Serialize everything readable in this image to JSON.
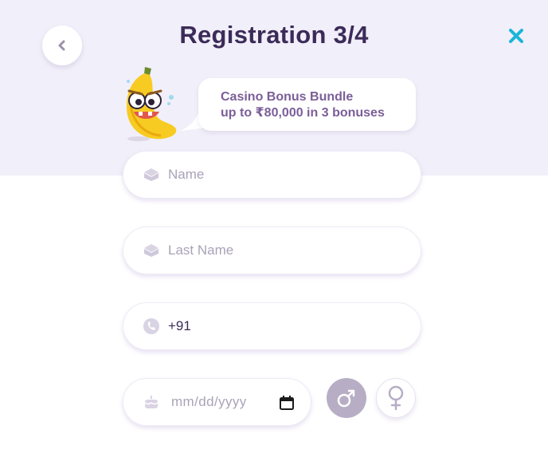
{
  "header": {
    "title": "Registration 3/4"
  },
  "promo": {
    "line1": "Casino Bonus Bundle",
    "line2": "up to ₹80,000 in 3 bonuses"
  },
  "form": {
    "name_placeholder": "Name",
    "last_name_placeholder": "Last Name",
    "phone_value": "+91",
    "date_placeholder": "mm/dd/yyyy",
    "gender_selected": "male"
  },
  "colors": {
    "header_bg": "#f1eff9",
    "title": "#3c2b59",
    "close_accent": "#1ab5d8",
    "promo_text": "#7b5e98",
    "male_selected_bg": "#b7aec5"
  },
  "icons": {
    "back": "chevron-left-icon",
    "close": "close-icon",
    "name": "user-card-icon",
    "last_name": "user-card-icon",
    "phone": "phone-icon",
    "date": "cake-icon",
    "calendar": "calendar-icon",
    "male": "male-icon",
    "female": "female-icon",
    "mascot": "banana-mascot"
  }
}
